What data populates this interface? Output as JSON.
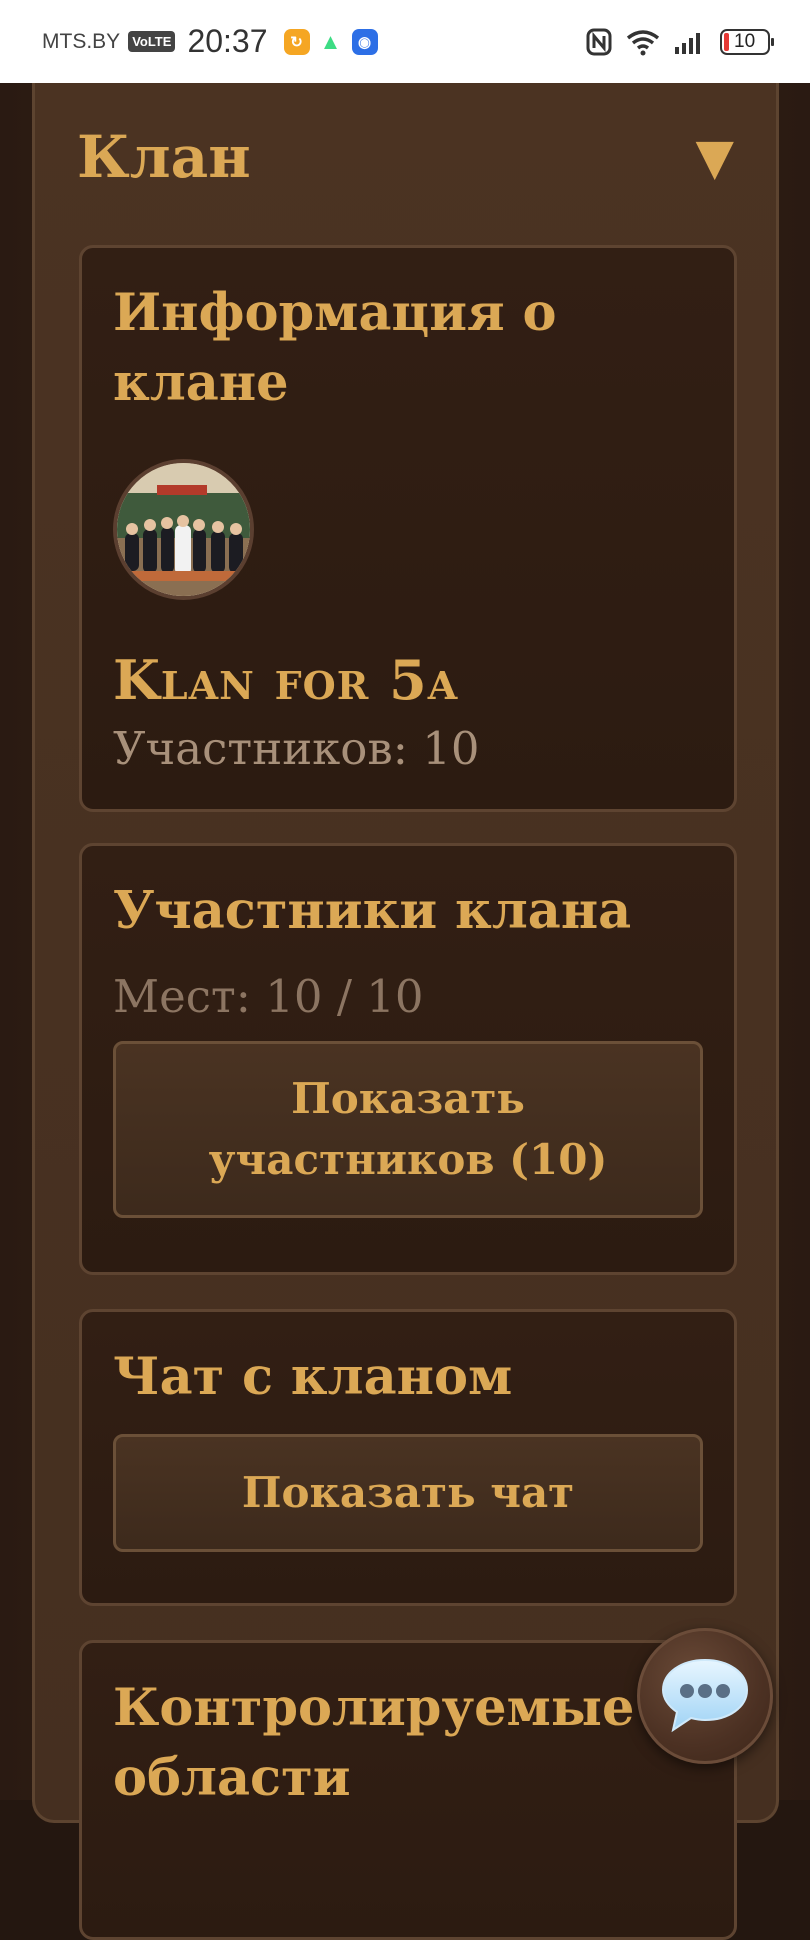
{
  "status_bar": {
    "carrier": "MTS.BY",
    "volte": "VoLTE",
    "time": "20:37",
    "battery": "10"
  },
  "panel": {
    "title": "Клан",
    "toggle_icon": "▼"
  },
  "info_card": {
    "title": "Информация о клане",
    "clan_name": "Klan for 5a",
    "members_text": "Участников: 10"
  },
  "members_card": {
    "title": "Участники клана",
    "slots_text": "Мест: 10 / 10",
    "show_button_line1": "Показать",
    "show_button_line2": "участников (10)"
  },
  "chat_card": {
    "title": "Чат с кланом",
    "show_chat_button": "Показать чат"
  },
  "territories_card": {
    "title": "Контролируемые области"
  },
  "colors": {
    "accent": "#dba855",
    "panel": "#4b3322",
    "card": "#2c1b11",
    "muted_text": "#a8907a"
  }
}
